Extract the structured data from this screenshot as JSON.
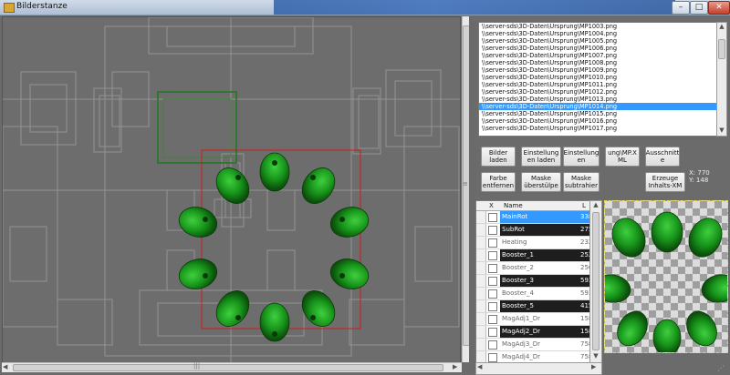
{
  "window": {
    "title": "Bilderstanze",
    "controls": {
      "minimize_icon": "minimize-icon",
      "maximize_icon": "maximize-icon",
      "close_icon": "close-icon"
    }
  },
  "files": {
    "items": [
      "\\\\server-sds\\3D-Daten\\Ursprung\\MP1003.png",
      "\\\\server-sds\\3D-Daten\\Ursprung\\MP1004.png",
      "\\\\server-sds\\3D-Daten\\Ursprung\\MP1005.png",
      "\\\\server-sds\\3D-Daten\\Ursprung\\MP1006.png",
      "\\\\server-sds\\3D-Daten\\Ursprung\\MP1007.png",
      "\\\\server-sds\\3D-Daten\\Ursprung\\MP1008.png",
      "\\\\server-sds\\3D-Daten\\Ursprung\\MP1009.png",
      "\\\\server-sds\\3D-Daten\\Ursprung\\MP1010.png",
      "\\\\server-sds\\3D-Daten\\Ursprung\\MP1011.png",
      "\\\\server-sds\\3D-Daten\\Ursprung\\MP1012.png",
      "\\\\server-sds\\3D-Daten\\Ursprung\\MP1013.png",
      "\\\\server-sds\\3D-Daten\\Ursprung\\MP1014.png",
      "\\\\server-sds\\3D-Daten\\Ursprung\\MP1015.png",
      "\\\\server-sds\\3D-Daten\\Ursprung\\MP1016.png",
      "\\\\server-sds\\3D-Daten\\Ursprung\\MP1017.png"
    ],
    "selected_index": 11
  },
  "buttons": {
    "bilder_laden": "Bilder laden",
    "einstellungen_laden": "Einstellung en laden",
    "einstellungen": "Einstellung en",
    "ung_mp_xml": "ung\\MP.X ML",
    "ausschnitte": "Ausschnitt e",
    "farbe_entfernen": "Farbe entfernen",
    "maske_ueberstuelpe": "Maske überstülpe",
    "maske_subtrahier": "Maske subtrahier",
    "erzeuge_inhalts_xml": "Erzeuge Inhalts-XM"
  },
  "coords": {
    "x_label": "X: 770",
    "y_label": "Y: 148"
  },
  "grid": {
    "columns": [
      "X",
      "Name",
      "L"
    ],
    "rows": [
      {
        "name": "MainRot",
        "value": "338",
        "style": "active"
      },
      {
        "name": "SubRot",
        "value": "275",
        "style": "dark"
      },
      {
        "name": "Heating",
        "value": "232",
        "style": "light"
      },
      {
        "name": "Booster_1",
        "value": "252",
        "style": "dark"
      },
      {
        "name": "Booster_2",
        "value": "250",
        "style": "light"
      },
      {
        "name": "Booster_3",
        "value": "593",
        "style": "dark"
      },
      {
        "name": "Booster_4",
        "value": "593",
        "style": "light"
      },
      {
        "name": "Booster_5",
        "value": "415",
        "style": "dark"
      },
      {
        "name": "MagAdj1_Dr",
        "value": "158",
        "style": "light"
      },
      {
        "name": "MagAdj2_Dr",
        "value": "158",
        "style": "dark"
      },
      {
        "name": "MagAdj3_Dr",
        "value": "758",
        "style": "light"
      },
      {
        "name": "MagAdj4_Dr",
        "value": "758",
        "style": "light"
      }
    ]
  },
  "colors": {
    "selection": "#3399ff",
    "canvas_bg": "#6d6d6d",
    "booster_green": "#22a322",
    "frame_red": "#d11a1a"
  }
}
